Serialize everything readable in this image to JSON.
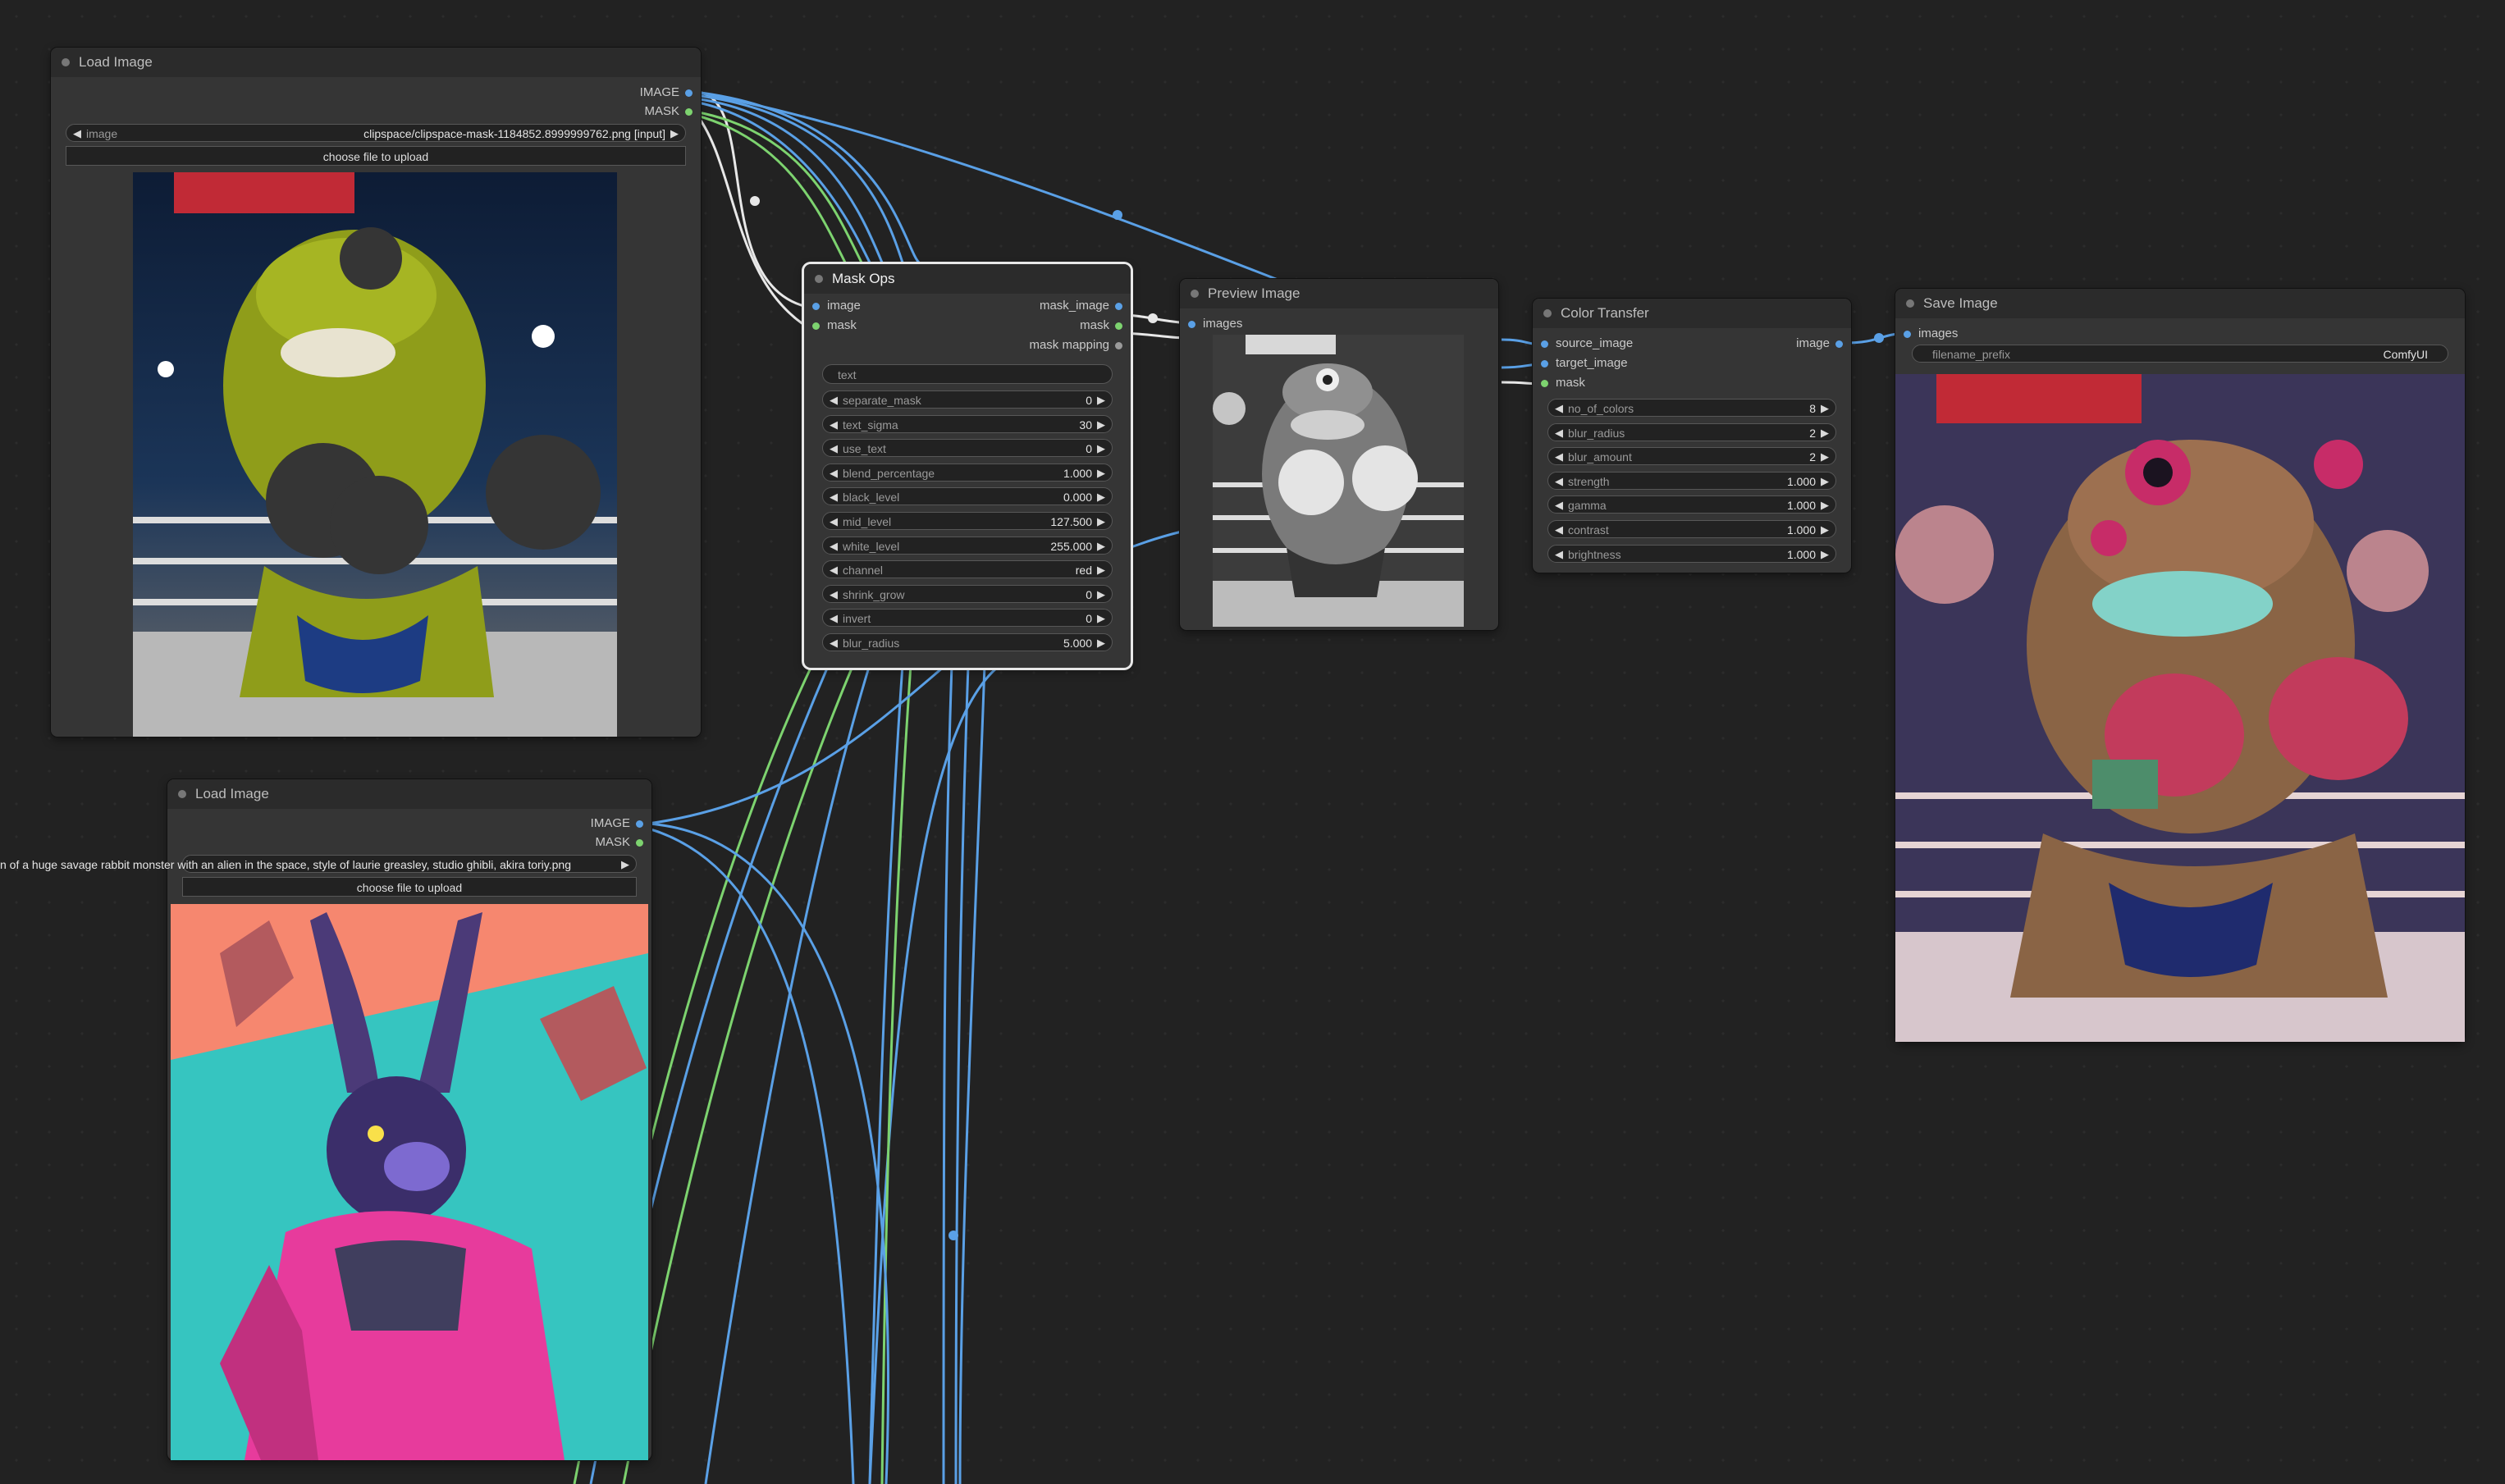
{
  "nodes": {
    "load_image_1": {
      "title": "Load Image",
      "outputs": [
        "IMAGE",
        "MASK"
      ],
      "image_widget": {
        "label": "image",
        "value": "clipspace/clipspace-mask-1184852.8999999762.png [input]"
      },
      "upload_label": "choose file to upload"
    },
    "load_image_2": {
      "title": "Load Image",
      "outputs": [
        "IMAGE",
        "MASK"
      ],
      "image_widget": {
        "label": "image",
        "value": "n of a huge savage rabbit monster with an alien in the space, style of laurie greasley, studio ghibli, akira toriy.png"
      },
      "upload_label": "choose file to upload"
    },
    "mask_ops": {
      "title": "Mask Ops",
      "inputs": [
        "image",
        "mask"
      ],
      "outputs": [
        "mask_image",
        "mask",
        "mask mapping"
      ],
      "text_placeholder": "text",
      "widgets": [
        {
          "label": "separate_mask",
          "value": "0"
        },
        {
          "label": "text_sigma",
          "value": "30"
        },
        {
          "label": "use_text",
          "value": "0"
        },
        {
          "label": "blend_percentage",
          "value": "1.000"
        },
        {
          "label": "black_level",
          "value": "0.000"
        },
        {
          "label": "mid_level",
          "value": "127.500"
        },
        {
          "label": "white_level",
          "value": "255.000"
        },
        {
          "label": "channel",
          "value": "red"
        },
        {
          "label": "shrink_grow",
          "value": "0"
        },
        {
          "label": "invert",
          "value": "0"
        },
        {
          "label": "blur_radius",
          "value": "5.000"
        }
      ]
    },
    "preview_image": {
      "title": "Preview Image",
      "inputs": [
        "images"
      ]
    },
    "color_transfer": {
      "title": "Color Transfer",
      "inputs": [
        "source_image",
        "target_image",
        "mask"
      ],
      "outputs": [
        "image"
      ],
      "widgets": [
        {
          "label": "no_of_colors",
          "value": "8"
        },
        {
          "label": "blur_radius",
          "value": "2"
        },
        {
          "label": "blur_amount",
          "value": "2"
        },
        {
          "label": "strength",
          "value": "1.000"
        },
        {
          "label": "gamma",
          "value": "1.000"
        },
        {
          "label": "contrast",
          "value": "1.000"
        },
        {
          "label": "brightness",
          "value": "1.000"
        }
      ]
    },
    "save_image": {
      "title": "Save Image",
      "inputs": [
        "images"
      ],
      "filename_prefix": {
        "label": "filename_prefix",
        "value": "ComfyUI"
      }
    }
  },
  "colors": {
    "image_wire": "#5aa0e6",
    "mask_wire": "#7dd36f",
    "selected_wire": "#e8e8e8",
    "node_bg": "#353535",
    "canvas_bg": "#222222"
  }
}
